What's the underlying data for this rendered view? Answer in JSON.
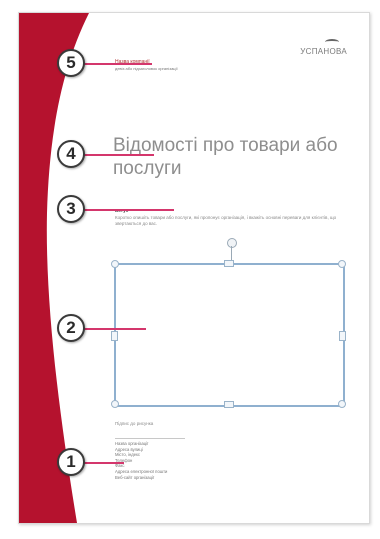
{
  "template": {
    "brand_text": "УСПАНОВА",
    "company_name": "Назва компанії",
    "company_slogan": "девіз або підзаголовок організації",
    "title": "Відомості про товари або послуги",
    "intro_label": "Вступ",
    "intro_text": "Коротко опишіть товари або послуги, які пропонує організація, і вкажіть основні переваги для клієнтів, що звертаються до вас.",
    "image_caption": "Підпис до рисунка",
    "contact_lines": [
      "Назва організації",
      "Адреса вулиці",
      "Місто, індекс",
      "Телефон",
      "Факс",
      "Адреса електронної пошти",
      "Веб-сайт організації"
    ]
  },
  "callouts": [
    "5",
    "4",
    "3",
    "2",
    "1"
  ],
  "colors": {
    "band": "#b5122e",
    "callout_line": "#d4366c",
    "frame": "#8fb0cf"
  }
}
